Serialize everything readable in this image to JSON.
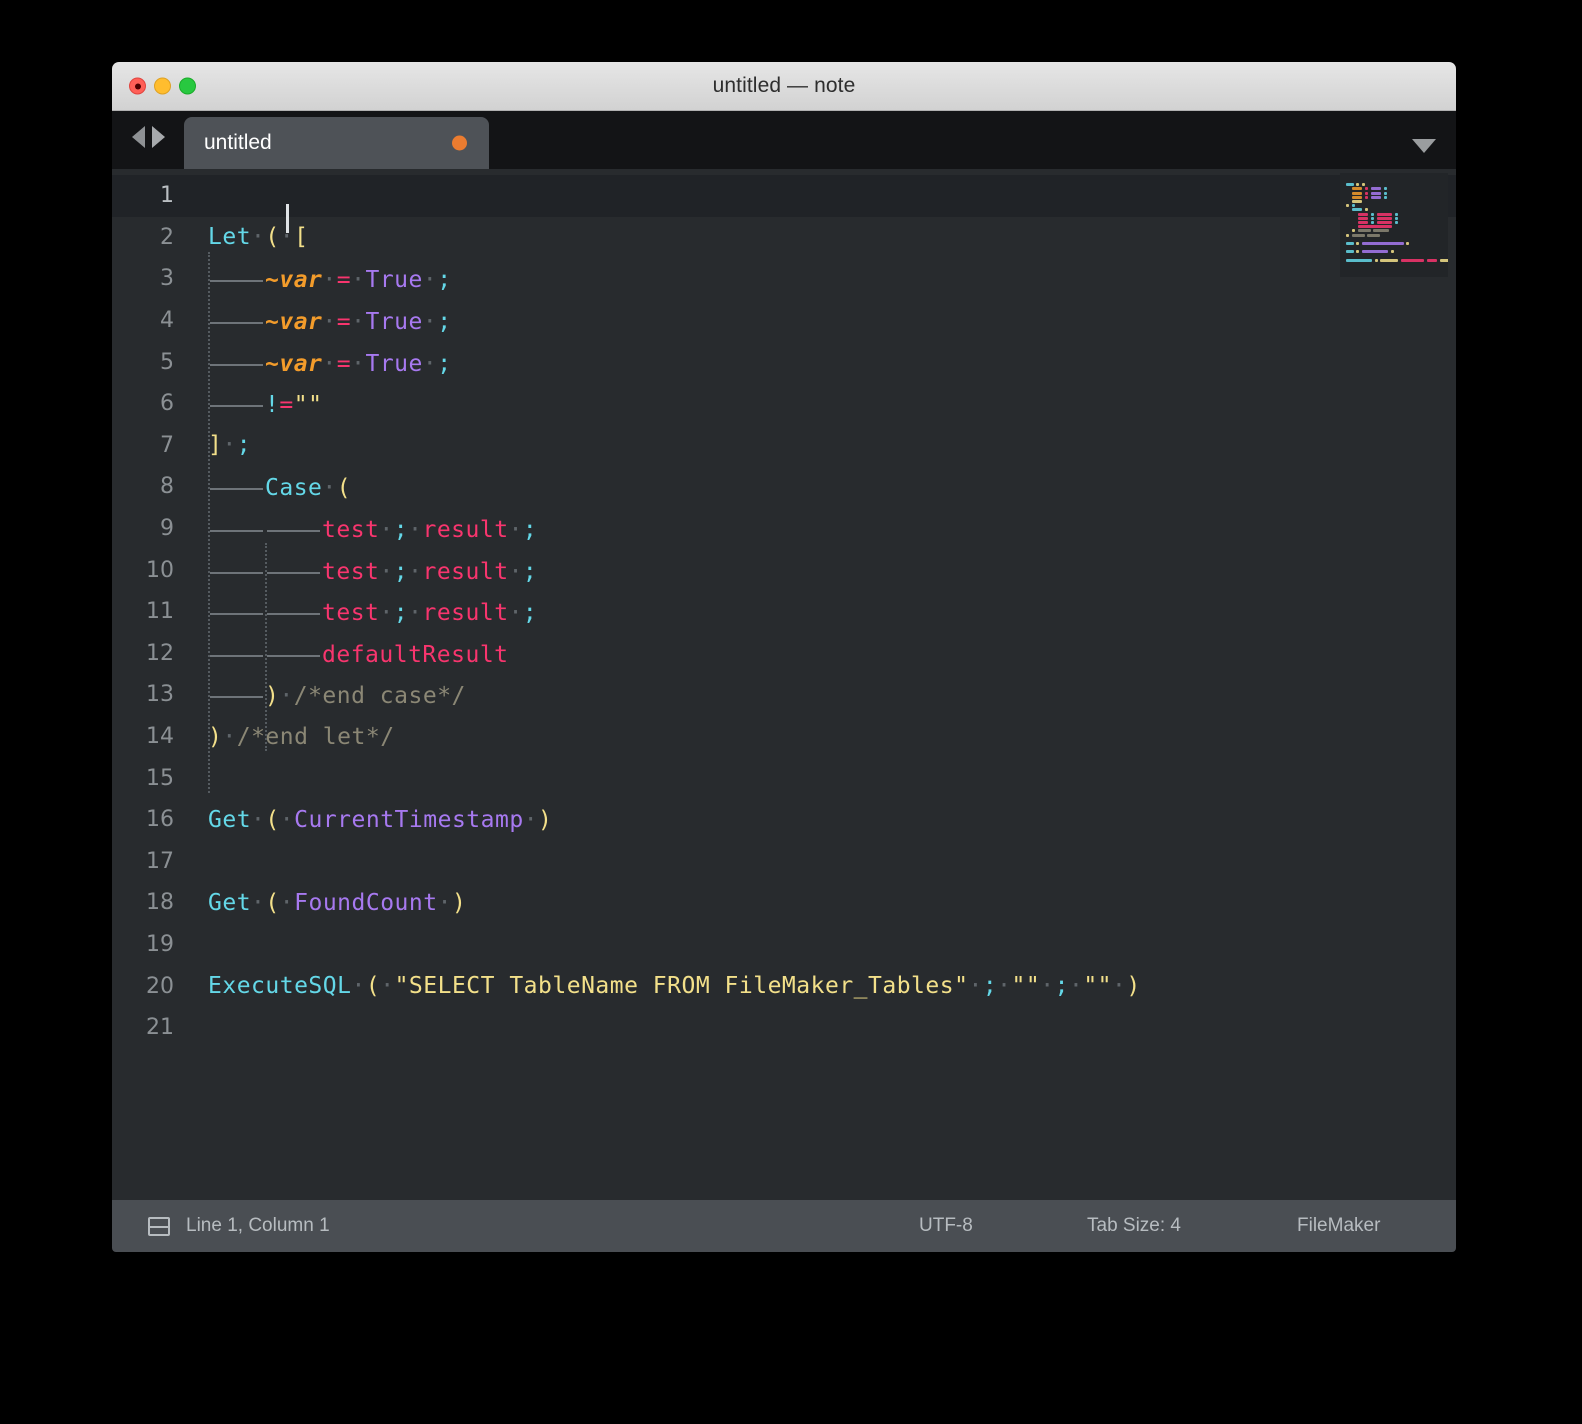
{
  "window": {
    "title": "untitled — note",
    "traffic_lights": [
      "close",
      "minimize",
      "zoom"
    ]
  },
  "tabbar": {
    "nav_back": "◀",
    "nav_forward": "▶",
    "tab_label": "untitled",
    "dirty_indicator": "unsaved-dot",
    "overflow_menu": "▼"
  },
  "editor": {
    "caret_position": "line-1-col-1",
    "lines": [
      {
        "n": "1",
        "text": ""
      },
      {
        "n": "2",
        "text": "Let ( ["
      },
      {
        "n": "3",
        "text": "\t~var = True ;"
      },
      {
        "n": "4",
        "text": "\t~var = True ;"
      },
      {
        "n": "5",
        "text": "\t~var = True ;"
      },
      {
        "n": "6",
        "text": "\t!=\"\""
      },
      {
        "n": "7",
        "text": "] ;"
      },
      {
        "n": "8",
        "text": "\tCase ("
      },
      {
        "n": "9",
        "text": "\t\ttest ; result ;"
      },
      {
        "n": "10",
        "text": "\t\ttest ; result ;"
      },
      {
        "n": "11",
        "text": "\t\ttest ; result ;"
      },
      {
        "n": "12",
        "text": "\t\tdefaultResult"
      },
      {
        "n": "13",
        "text": "\t) /*end case*/"
      },
      {
        "n": "14",
        "text": ") /*end let*/"
      },
      {
        "n": "15",
        "text": ""
      },
      {
        "n": "16",
        "text": "Get ( CurrentTimestamp )"
      },
      {
        "n": "17",
        "text": ""
      },
      {
        "n": "18",
        "text": "Get ( FoundCount )"
      },
      {
        "n": "19",
        "text": ""
      },
      {
        "n": "20",
        "text": "ExecuteSQL ( \"SELECT TableName FROM FileMaker_Tables\" ; \"\" ; \"\" )"
      },
      {
        "n": "21",
        "text": ""
      }
    ],
    "tokens": {
      "let": "Let",
      "case": "Case",
      "get": "Get",
      "executesql": "ExecuteSQL",
      "var": "~var",
      "true": "True",
      "test": "test",
      "result": "result",
      "defaultResult": "defaultResult",
      "currentTimestamp": "CurrentTimestamp",
      "foundCount": "FoundCount",
      "sql_string": "\"SELECT TableName FROM FileMaker_Tables\"",
      "empty_string": "\"\"",
      "comment_case": "/*end case*/",
      "comment_let": "/*end let*/",
      "paren_open": "(",
      "paren_close": ")",
      "bracket_open": "[",
      "bracket_close": "]",
      "semicolon": ";",
      "equals": "=",
      "bang": "!",
      "empty_quotes": "\"\""
    },
    "colors": {
      "background": "#282b2e",
      "active_line": "#202327",
      "gutter_text": "#8b9094",
      "function": "#64d8e8",
      "paren": "#f3e08a",
      "variable": "#f39c2b",
      "operator": "#f8356e",
      "constant": "#a779f0",
      "keyword": "#f8356e",
      "string": "#f3e08a",
      "comment": "#8b8775",
      "whitespace": "#5f656a",
      "tab_accent": "#eb7c30"
    }
  },
  "statusbar": {
    "pane_icon": "split-pane-icon",
    "cursor": "Line 1, Column 1",
    "encoding": "UTF-8",
    "tab_size": "Tab Size: 4",
    "syntax": "FileMaker"
  }
}
